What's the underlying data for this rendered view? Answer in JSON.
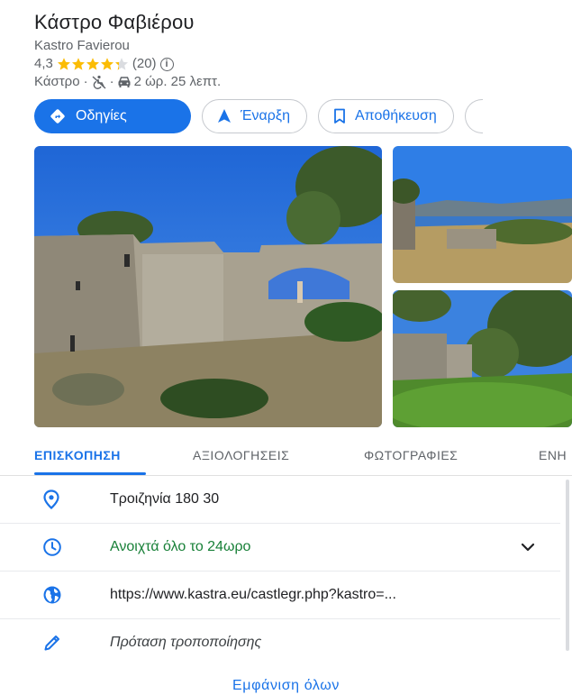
{
  "place": {
    "title": "Κάστρο Φαβιέρου",
    "subtitle": "Kastro Favierou",
    "rating": "4,3",
    "stars": 4.3,
    "review_count": "(20)",
    "info_icon": "i",
    "category": "Κάστρο",
    "separator": "·",
    "travel_time": "2 ώρ. 25 λεπτ."
  },
  "actions": {
    "directions": "Οδηγίες",
    "start": "Έναρξη",
    "save": "Αποθήκευση"
  },
  "tabs": {
    "overview": "ΕΠΙΣΚΟΠΗΣΗ",
    "reviews": "ΑΞΙΟΛΟΓΗΣΕΙΣ",
    "photos": "ΦΩΤΟΓΡΑΦΙΕΣ",
    "more": "ΕΝΗ"
  },
  "details": {
    "address": "Τροιζηνία 180 30",
    "hours": "Ανοιχτά όλο το 24ωρο",
    "website": "https://www.kastra.eu/castlegr.php?kastro=...",
    "suggest_edit": "Πρόταση τροποποίησης"
  },
  "show_all": "Εμφάνιση όλων",
  "colors": {
    "accent": "#1a73e8",
    "star": "#fbbc04",
    "open_green": "#188038"
  },
  "icons": {
    "accessibility": "not-accessible-icon",
    "car": "car-icon",
    "directions": "directions-icon",
    "navigation": "navigation-arrow-icon",
    "bookmark": "bookmark-icon",
    "location": "location-pin-icon",
    "clock": "clock-icon",
    "globe": "globe-icon",
    "pencil": "pencil-icon",
    "chevron": "chevron-down-icon"
  }
}
